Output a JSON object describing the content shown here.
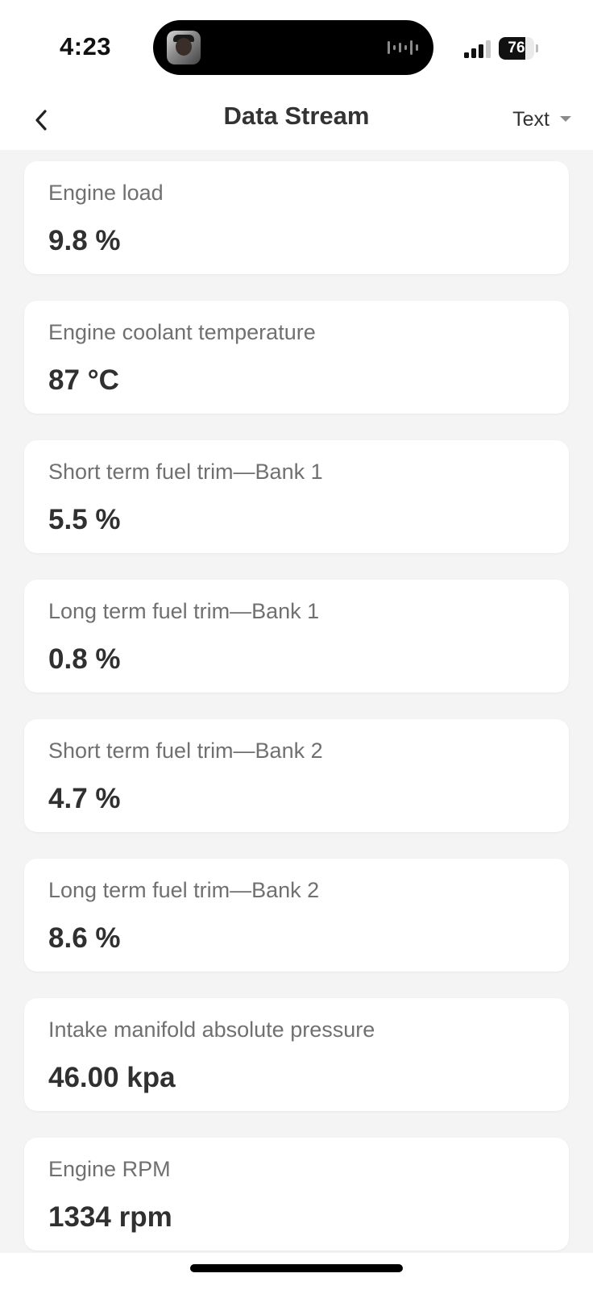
{
  "status_bar": {
    "time": "4:23",
    "battery_level": 76,
    "battery_text": "76"
  },
  "nav": {
    "title": "Data Stream",
    "view_mode": "Text"
  },
  "icons": {
    "back": "chevron-left-icon",
    "dropdown": "caret-down-icon",
    "signal": "cellular-signal-icon",
    "battery": "battery-icon",
    "audio": "audio-waveform-icon"
  },
  "data_stream": [
    {
      "label": "Engine load",
      "value": "9.8 %"
    },
    {
      "label": "Engine coolant temperature",
      "value": "87 °C"
    },
    {
      "label": "Short term fuel trim—Bank 1",
      "value": "5.5 %"
    },
    {
      "label": "Long term fuel trim—Bank 1",
      "value": "0.8 %"
    },
    {
      "label": "Short term fuel trim—Bank 2",
      "value": "4.7 %"
    },
    {
      "label": "Long term fuel trim—Bank 2",
      "value": "8.6 %"
    },
    {
      "label": "Intake manifold absolute pressure",
      "value": "46.00 kpa"
    },
    {
      "label": "Engine RPM",
      "value": "1334 rpm"
    }
  ]
}
